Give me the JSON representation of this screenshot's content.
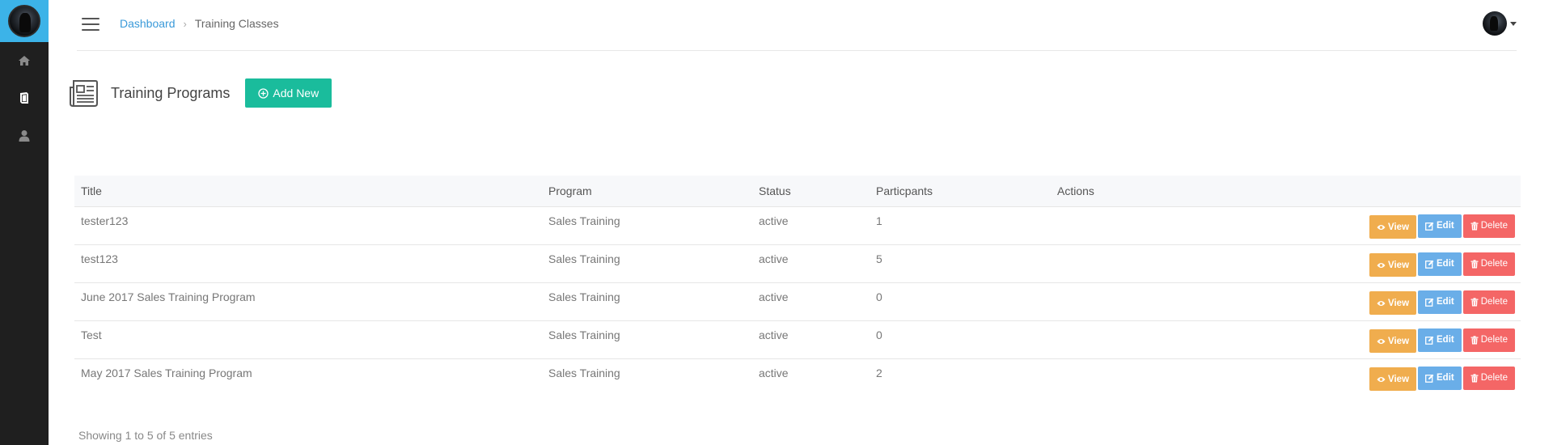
{
  "sidebar": {
    "items": [
      {
        "icon": "home-icon"
      },
      {
        "icon": "book-icon"
      },
      {
        "icon": "user-icon"
      }
    ]
  },
  "header": {
    "breadcrumb": {
      "root": "Dashboard",
      "separator": "›",
      "current": "Training Classes"
    }
  },
  "page": {
    "title": "Training Programs",
    "add_button_label": "Add New"
  },
  "table": {
    "columns": [
      "Title",
      "Program",
      "Status",
      "Particpants",
      "Actions"
    ],
    "rows": [
      {
        "title": "tester123",
        "program": "Sales Training",
        "status": "active",
        "participants": "1"
      },
      {
        "title": "test123",
        "program": "Sales Training",
        "status": "active",
        "participants": "5"
      },
      {
        "title": "June 2017 Sales Training Program",
        "program": "Sales Training",
        "status": "active",
        "participants": "0"
      },
      {
        "title": "Test",
        "program": "Sales Training",
        "status": "active",
        "participants": "0"
      },
      {
        "title": "May 2017 Sales Training Program",
        "program": "Sales Training",
        "status": "active",
        "participants": "2"
      }
    ],
    "actions": {
      "view": "View",
      "edit": "Edit",
      "delete": "Delete"
    },
    "info": "Showing 1 to 5 of 5 entries"
  },
  "colors": {
    "sidebar_bg": "#1f1f1f",
    "sidebar_top": "#3cb3e8",
    "add_button": "#1abc9c",
    "view": "#f0ad4e",
    "edit": "#6aaee8",
    "delete": "#f46666",
    "link": "#3a9ad9"
  }
}
